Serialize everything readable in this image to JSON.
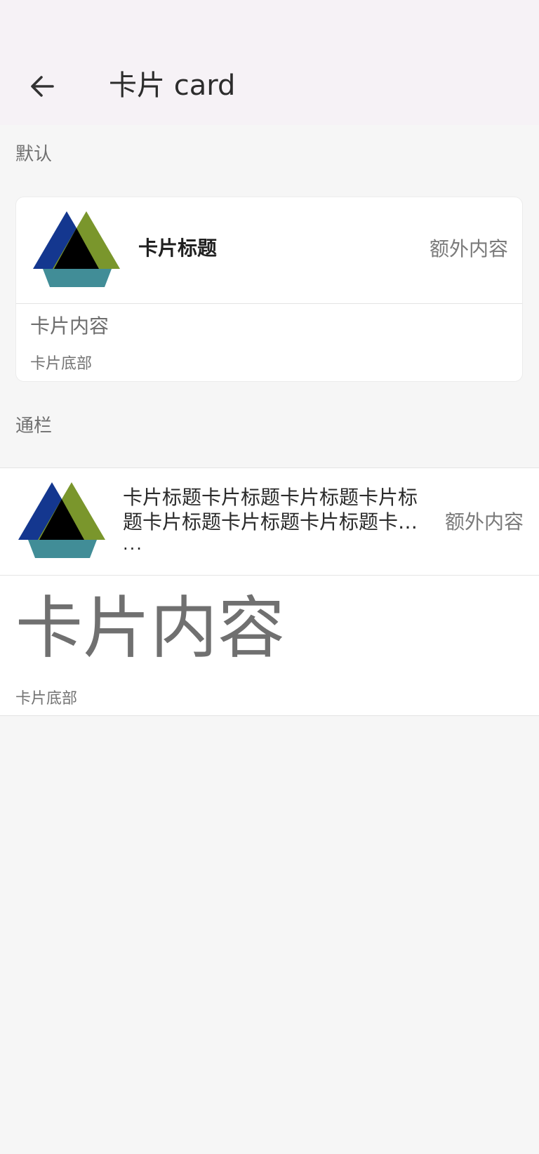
{
  "app_bar": {
    "title": "卡片 card",
    "back_icon": "arrow-left-icon"
  },
  "sections": [
    {
      "label": "默认",
      "card": {
        "logo_icon": "triangle-logo-icon",
        "title": "卡片标题",
        "extra": "额外内容",
        "content": "卡片内容",
        "footer": "卡片底部"
      }
    },
    {
      "label": "通栏",
      "card": {
        "logo_icon": "triangle-logo-icon",
        "title": "卡片标题卡片标题卡片标题卡片标题卡片标题卡片标题卡片标题卡片标题",
        "title_ellipsis": "...",
        "extra": "额外内容",
        "content": "卡片内容",
        "footer": "卡片底部"
      }
    }
  ],
  "colors": {
    "status_bar": "#f6f2f6",
    "app_bar": "#f6f2f6",
    "page_background": "#f6f6f6",
    "card_background": "#ffffff",
    "logo_blue": "#14378f",
    "logo_green": "#7a962c",
    "logo_teal": "#418d97",
    "logo_black": "#000000"
  }
}
